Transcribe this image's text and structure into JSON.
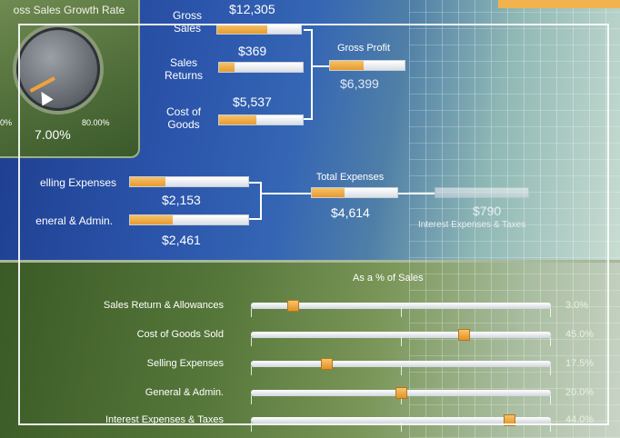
{
  "gauge": {
    "title": "oss Sales Growth Rate",
    "min_label": "0%",
    "max_label": "80.00%",
    "value": "7.00%"
  },
  "income": {
    "gross_sales": {
      "label": "Gross Sales",
      "value": "$12,305",
      "fill": 0.6
    },
    "sales_returns": {
      "label": "Sales Returns",
      "value": "$369",
      "fill": 0.18
    },
    "cost_of_goods": {
      "label": "Cost of Goods",
      "value": "$5,537",
      "fill": 0.45
    },
    "gross_profit": {
      "label": "Gross Profit",
      "value": "$6,399",
      "fill": 0.45
    },
    "selling_expenses": {
      "label": "elling Expenses",
      "value": "$2,153",
      "fill": 0.3
    },
    "general_admin": {
      "label": "eneral & Admin.",
      "value": "$2,461",
      "fill": 0.36
    },
    "total_expenses": {
      "label": "Total Expenses",
      "value": "$4,614",
      "fill": 0.38
    },
    "interest_taxes": {
      "label": "Interest Expenses & Taxes",
      "value": "$790"
    }
  },
  "sliders": {
    "heading": "As a % of Sales",
    "rows": [
      {
        "label": "Sales Return & Allowances",
        "value": "3.0%",
        "fraction": 0.14
      },
      {
        "label": "Cost of Goods Sold",
        "value": "45.0%",
        "fraction": 0.71
      },
      {
        "label": "Selling Expenses",
        "value": "17.5%",
        "fraction": 0.25
      },
      {
        "label": "General & Admin.",
        "value": "20.0%",
        "fraction": 0.5
      },
      {
        "label": "Interest Expenses & Taxes",
        "value": "44.0%",
        "fraction": 0.86
      }
    ]
  },
  "colors": {
    "accent": "#f2b24e",
    "top_bg": "#2b55ab",
    "bottom_bg": "#56773a"
  }
}
